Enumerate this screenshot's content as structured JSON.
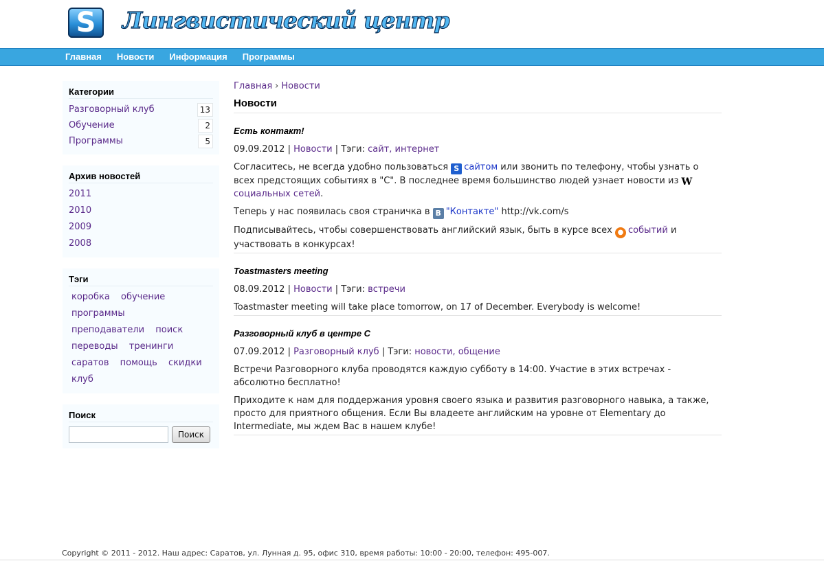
{
  "header": {
    "logo_letter": "S",
    "site_title": "Лингвистический центр"
  },
  "nav": {
    "items": [
      {
        "label": "Главная"
      },
      {
        "label": "Новости"
      },
      {
        "label": "Информация"
      },
      {
        "label": "Программы"
      }
    ]
  },
  "sidebar": {
    "categories": {
      "title": "Категории",
      "items": [
        {
          "label": "Разговорный клуб",
          "count": "13"
        },
        {
          "label": "Обучение",
          "count": "2"
        },
        {
          "label": "Программы",
          "count": "5"
        }
      ]
    },
    "archive": {
      "title": "Архив новостей",
      "years": [
        "2011",
        "2010",
        "2009",
        "2008"
      ]
    },
    "tags": {
      "title": "Тэги",
      "items": [
        "коробка",
        "обучение",
        "программы",
        "преподаватели",
        "поиск",
        "переводы",
        "тренинги",
        "саратов",
        "помощь",
        "скидки",
        "клуб"
      ]
    },
    "search": {
      "title": "Поиск",
      "input_value": "",
      "button_label": "Поиск"
    }
  },
  "main": {
    "breadcrumb": {
      "home": "Главная",
      "separator": "›",
      "current": "Новости"
    },
    "page_title": "Новости",
    "posts": [
      {
        "title": "Есть контакт!",
        "date": "09.09.2012",
        "category": "Новости",
        "tags_label": "Тэги:",
        "tags": "сайт, интернет",
        "p1_a": "Согласитесь, не всегда удобно пользоваться",
        "p1_link1": "сайтом",
        "p1_b": "или звонить по телефону, чтобы узнать о всех предстоящих событиях в \"С\". В последнее время большинство людей узнает новости из",
        "p1_w": "W",
        "p1_link2": "социальных сетей",
        "p1_c": ".",
        "p2_a": "Теперь у нас появилась своя страничка в",
        "p2_vk": "B",
        "p2_link": "\"Контакте\"",
        "p2_b": "http://vk.com/s",
        "p3_a": "Подписывайтесь, чтобы совершенствовать английский язык, быть в курсе всех",
        "p3_link": "событий",
        "p3_b": "и участвовать в конкурсах!"
      },
      {
        "title": "Toastmasters meeting",
        "date": "08.09.2012",
        "category": "Новости",
        "tags_label": "Тэги:",
        "tags": "встречи",
        "p1": "Toastmaster meeting will take place tomorrow, on 17 of December. Everybody is welcome!"
      },
      {
        "title": "Разговорный клуб в центре С",
        "date": "07.09.2012",
        "category": "Разговорный клуб",
        "tags_label": "Тэги:",
        "tags": "новости, общение",
        "p1": "Встречи Разговорного клуба проводятся каждую субботу в 14:00. Участие в этих встречах - абсолютно бесплатно!",
        "p2": "Приходите к нам для поддержания уровня своего языка и развития разговорного навыка, а также, просто для приятного общения. Если Вы владеете английским на уровне от Elementary до Intermediate, мы ждем Вас в нашем клубе!"
      }
    ]
  },
  "footer": {
    "text": "Copyright © 2011 - 2012. Наш адрес: Саратов, ул. Лунная д. 95, офис 310, время работы: 10:00 - 20:00, телефон: 495-007."
  }
}
